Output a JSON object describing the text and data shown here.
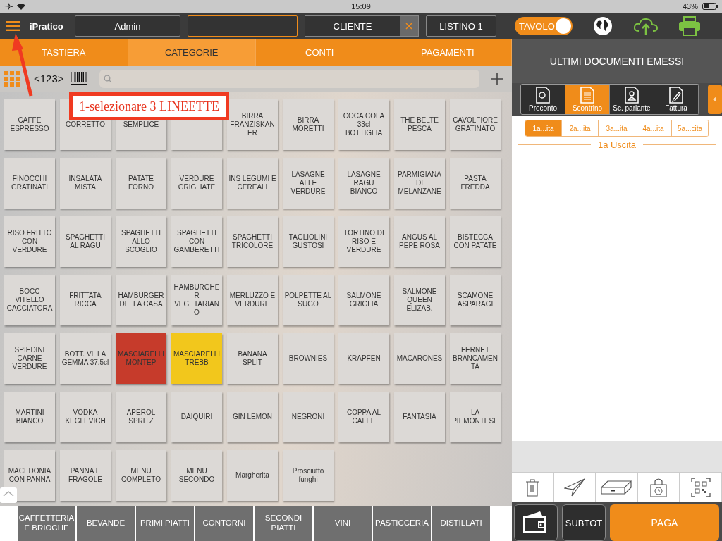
{
  "status_bar": {
    "time": "15:09",
    "battery": "43%"
  },
  "header": {
    "logo": "iPratico",
    "operator": "Admin",
    "customer": "CLIENTE",
    "price_list": "LISTINO 1",
    "table_toggle": {
      "label": "TAVOLO",
      "on": true
    }
  },
  "tabs": [
    {
      "label": "TASTIERA",
      "selected": false
    },
    {
      "label": "CATEGORIE",
      "selected": true
    },
    {
      "label": "CONTI",
      "selected": false
    },
    {
      "label": "PAGAMENTI",
      "selected": false
    }
  ],
  "toolbar": {
    "counter": "<123>"
  },
  "tiles": [
    {
      "label": "CAFFE ESPRESSO"
    },
    {
      "label": "CORRETTO"
    },
    {
      "label": "SEMPLICE"
    },
    {
      "kind": "blank"
    },
    {
      "label": "BIRRA FRANZISKANER"
    },
    {
      "label": "BIRRA MORETTI"
    },
    {
      "label": "COCA COLA 33cl BOTTIGLIA"
    },
    {
      "label": "THE BELTE PESCA"
    },
    {
      "label": "CAVOLFIORE GRATINATO"
    },
    {
      "label": "FINOCCHI GRATINATI"
    },
    {
      "label": "INSALATA MISTA"
    },
    {
      "label": "PATATE FORNO"
    },
    {
      "label": "VERDURE GRIGLIATE"
    },
    {
      "label": "INS LEGUMI E CEREALI"
    },
    {
      "label": "LASAGNE ALLE VERDURE"
    },
    {
      "label": "LASAGNE RAGU BIANCO"
    },
    {
      "label": "PARMIGIANA DI MELANZANE"
    },
    {
      "label": "PASTA FREDDA"
    },
    {
      "label": "RISO FRITTO CON VERDURE"
    },
    {
      "label": "SPAGHETTI AL RAGU"
    },
    {
      "label": "SPAGHETTI ALLO SCOGLIO"
    },
    {
      "label": "SPAGHETTI CON GAMBERETTI"
    },
    {
      "label": "SPAGHETTI TRICOLORE"
    },
    {
      "label": "TAGLIOLINI GUSTOSI"
    },
    {
      "label": "TORTINO DI RISO E VERDURE"
    },
    {
      "label": "ANGUS AL PEPE ROSA"
    },
    {
      "label": "BISTECCA CON PATATE"
    },
    {
      "label": "BOCC VITELLO CACCIATORA"
    },
    {
      "label": "FRITTATA RICCA"
    },
    {
      "label": "HAMBURGER DELLA CASA"
    },
    {
      "label": "HAMBURGHER VEGETARIANO"
    },
    {
      "label": "MERLUZZO E VERDURE"
    },
    {
      "label": "POLPETTE AL SUGO"
    },
    {
      "label": "SALMONE GRIGLIA"
    },
    {
      "label": "SALMONE QUEEN ELIZAB."
    },
    {
      "label": "SCAMONE ASPARAGI"
    },
    {
      "label": "SPIEDINI CARNE VERDURE"
    },
    {
      "label": "BOTT. VILLA GEMMA 37.5cl"
    },
    {
      "label": "MASCIARELLI MONTEP",
      "color": "#c63b2b"
    },
    {
      "label": "MASCIARELLI TREBB",
      "color": "#f2c71c"
    },
    {
      "label": "BANANA SPLIT"
    },
    {
      "label": "BROWNIES"
    },
    {
      "label": "KRAPFEN"
    },
    {
      "label": "MACARONES"
    },
    {
      "label": "FERNET BRANCAMENTA"
    },
    {
      "label": "MARTINI BIANCO"
    },
    {
      "label": "VODKA KEGLEVICH"
    },
    {
      "label": "APEROL SPRITZ"
    },
    {
      "label": "DAIQUIRI"
    },
    {
      "label": "GIN LEMON"
    },
    {
      "label": "NEGRONI"
    },
    {
      "label": "COPPA AL CAFFE"
    },
    {
      "label": "FANTASIA"
    },
    {
      "label": "LA PIEMONTESE"
    },
    {
      "label": "MACEDONIA CON PANNA"
    },
    {
      "label": "PANNA E FRAGOLE"
    },
    {
      "label": "MENU COMPLETO"
    },
    {
      "label": "MENU SECONDO"
    },
    {
      "label": "Margherita"
    },
    {
      "label": "Prosciutto funghi"
    }
  ],
  "categories": [
    "CAFFETTERIA E BRIOCHE",
    "BEVANDE",
    "PRIMI PIATTI",
    "CONTORNI",
    "SECONDI PIATTI",
    "VINI",
    "PASTICCERIA",
    "DISTILLATI"
  ],
  "right_panel": {
    "title": "ULTIMI DOCUMENTI EMESSI",
    "doc_types": [
      {
        "label": "Preconto",
        "selected": false
      },
      {
        "label": "Scontrino",
        "selected": true
      },
      {
        "label": "Sc. parlante",
        "selected": false
      },
      {
        "label": "Fattura",
        "selected": false
      }
    ],
    "exits": [
      {
        "label": "1a...ita",
        "selected": true
      },
      {
        "label": "2a...ita",
        "selected": false
      },
      {
        "label": "3a...ita",
        "selected": false
      },
      {
        "label": "4a...ita",
        "selected": false
      },
      {
        "label": "5a...cita",
        "selected": false
      }
    ],
    "section_title": "1a Uscita",
    "subtotal": "SUBTOT",
    "pay": "PAGA"
  },
  "annotation": {
    "callout": "1-selezionare 3 LINEETTE"
  }
}
